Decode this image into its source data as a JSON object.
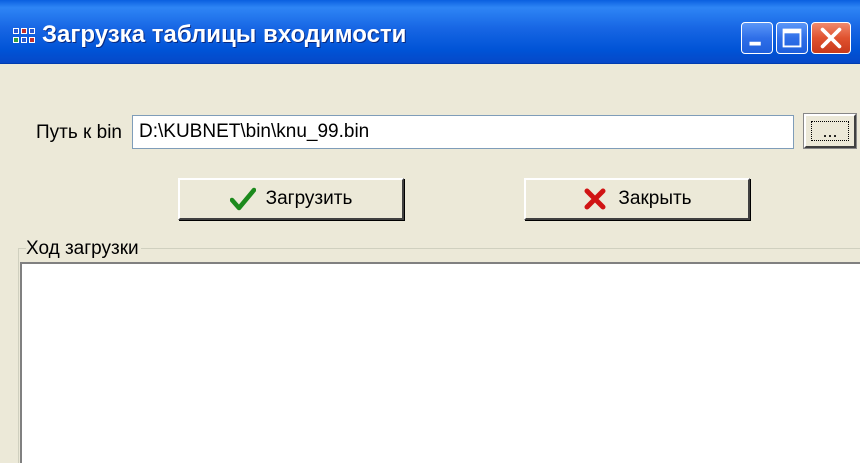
{
  "window": {
    "title": "Загрузка таблицы входимости",
    "colors": {
      "titlebar": "#0A5FE0",
      "face": "#ECE9D8",
      "close": "#E0522F"
    }
  },
  "form": {
    "path_label": "Путь к bin",
    "path_value": "D:\\KUBNET\\bin\\knu_99.bin",
    "browse_label": "...",
    "load_button": "Загрузить",
    "close_button": "Закрыть"
  },
  "progress": {
    "group_label": "Ход загрузки",
    "log_text": ""
  }
}
